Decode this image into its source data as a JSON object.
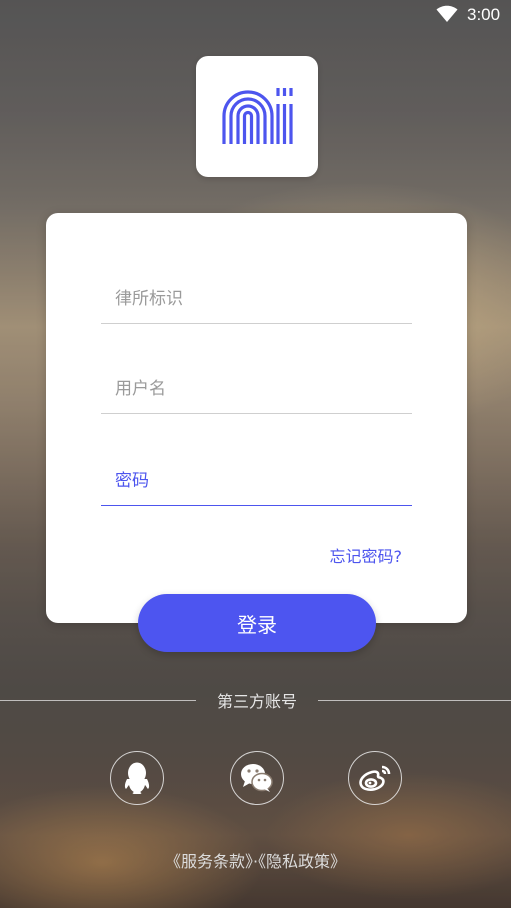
{
  "status_bar": {
    "time": "3:00",
    "wifi_icon": "wifi-icon"
  },
  "logo": {
    "icon": "ai-logo-icon",
    "color": "#4d55ee"
  },
  "form": {
    "firm_id_placeholder": "律所标识",
    "username_placeholder": "用户名",
    "password_placeholder": "密码",
    "forgot_label": "忘记密码?"
  },
  "login_button": {
    "label": "登录",
    "color": "#4d55f0"
  },
  "third_party": {
    "label": "第三方账号",
    "providers": [
      {
        "name": "QQ",
        "icon": "qq-icon"
      },
      {
        "name": "WeChat",
        "icon": "wechat-icon"
      },
      {
        "name": "Weibo",
        "icon": "weibo-icon"
      }
    ]
  },
  "legal": {
    "terms": "《服务条款》",
    "separator": "·",
    "privacy": "《隐私政策》"
  },
  "colors": {
    "accent": "#4d55ee",
    "card": "#ffffff"
  }
}
